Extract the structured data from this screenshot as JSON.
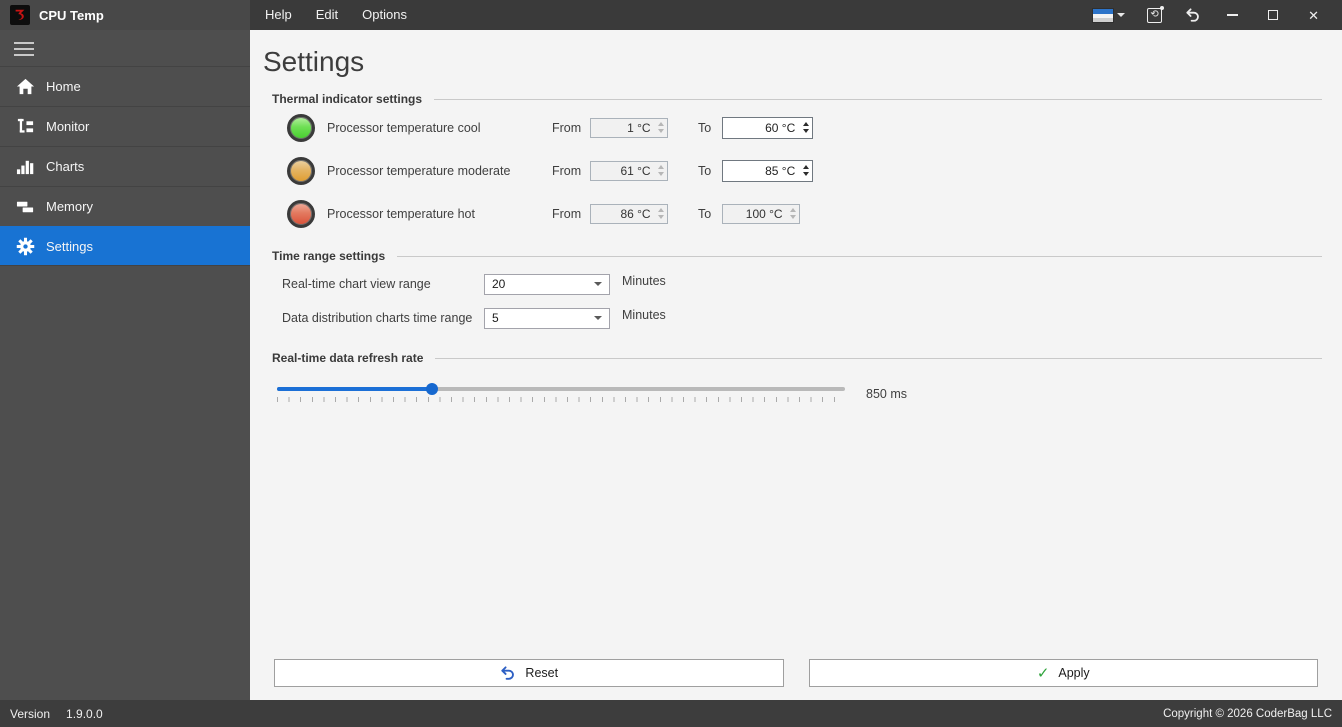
{
  "window": {
    "title": "CPU Temp",
    "menu": {
      "help": "Help",
      "edit": "Edit",
      "options": "Options"
    }
  },
  "sidebar": {
    "items": [
      {
        "label": "Home"
      },
      {
        "label": "Monitor"
      },
      {
        "label": "Charts"
      },
      {
        "label": "Memory"
      },
      {
        "label": "Settings",
        "selected": true
      }
    ]
  },
  "page": {
    "title": "Settings"
  },
  "thermal": {
    "title": "Thermal indicator settings",
    "from_label": "From",
    "to_label": "To",
    "rows": [
      {
        "label": "Processor temperature cool",
        "from": "1 °C",
        "to": "60 °C",
        "led_color": "#45cf2d"
      },
      {
        "label": "Processor temperature moderate",
        "from": "61 °C",
        "to": "85 °C",
        "led_color": "#df9c2f"
      },
      {
        "label": "Processor temperature hot",
        "from": "86 °C",
        "to": "100 °C",
        "led_color": "#da5038"
      }
    ]
  },
  "time_range": {
    "title": "Time range settings",
    "rows": [
      {
        "label": "Real-time chart view range",
        "value": "20",
        "unit": "Minutes"
      },
      {
        "label": "Data distribution charts time range",
        "value": "5",
        "unit": "Minutes"
      }
    ]
  },
  "refresh": {
    "title": "Real-time data refresh rate",
    "value": "850 ms",
    "fill_percent": 27.3
  },
  "actions": {
    "reset": "Reset",
    "apply": "Apply"
  },
  "statusbar": {
    "version_label": "Version",
    "version": "1.9.0.0",
    "copyright": "Copyright © 2026 CoderBag LLC"
  },
  "colors": {
    "accent_blue": "#1873d3",
    "slider_blue": "#1b6fd6",
    "led_cool": "#45cf2d",
    "led_moderate": "#df9c2f",
    "led_hot": "#da5038",
    "titlebar_bg": "#3a3a3a",
    "sidebar_bg": "#4e4e4e",
    "content_bg": "#f4f4f4"
  }
}
